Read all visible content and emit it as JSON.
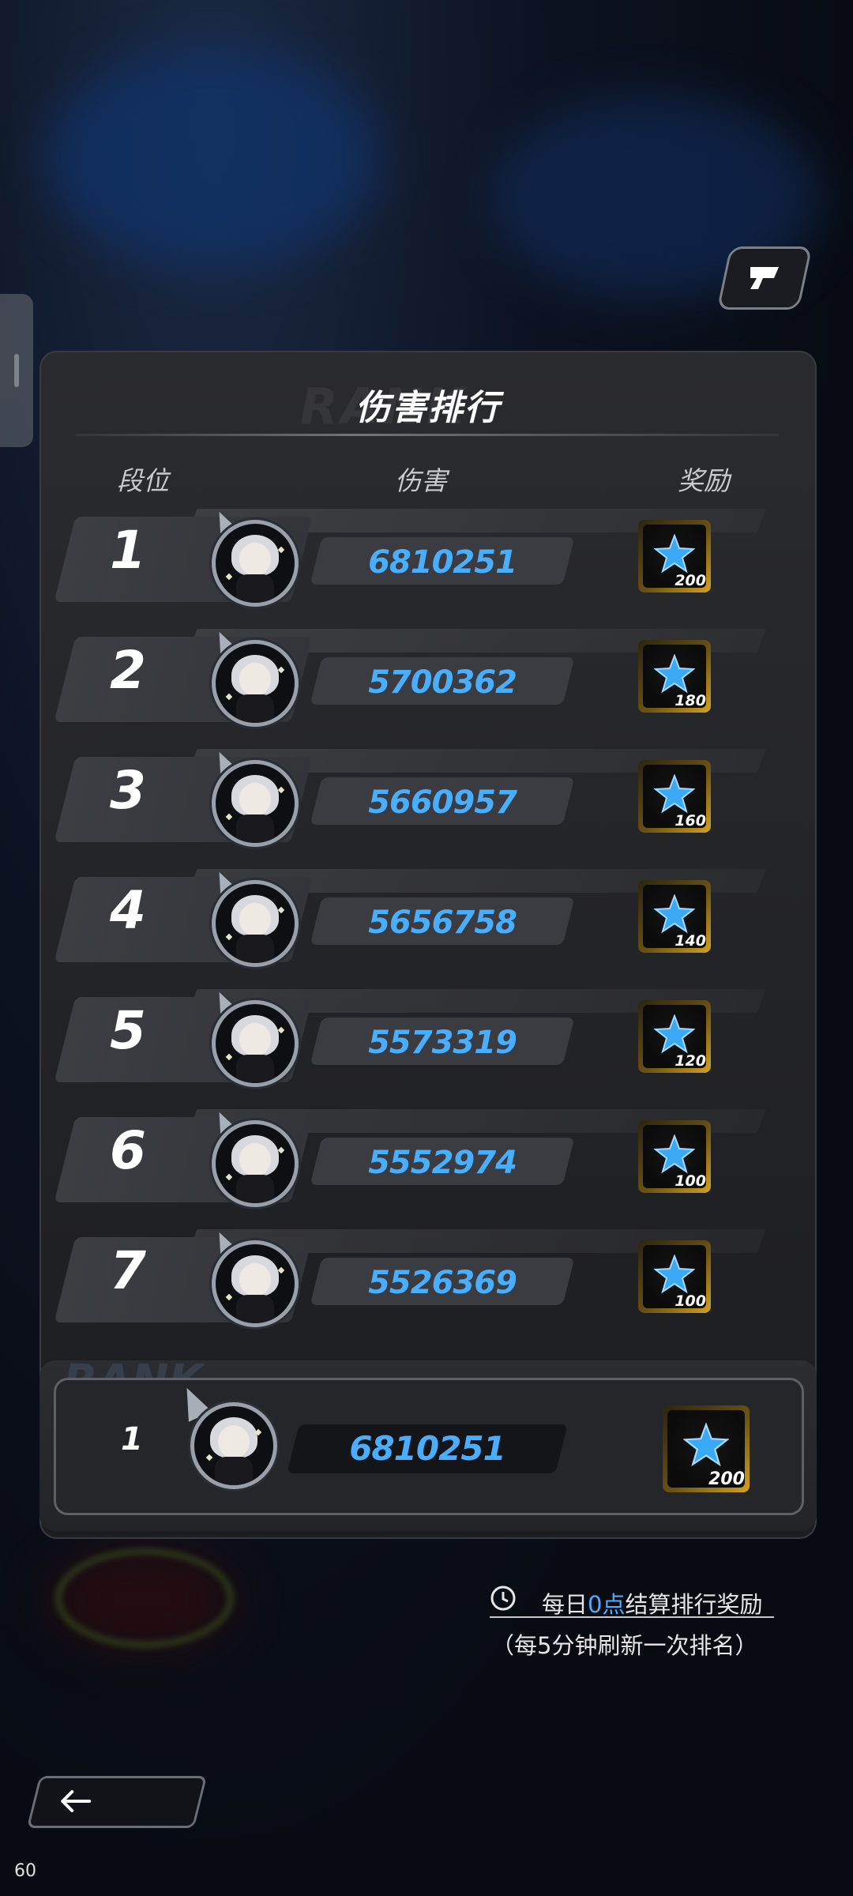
{
  "panel": {
    "title": "伤害排行",
    "columns": {
      "rank": "段位",
      "damage": "伤害",
      "reward": "奖励"
    }
  },
  "rows": [
    {
      "rank": "1",
      "damage": "6810251",
      "reward_qty": "200"
    },
    {
      "rank": "2",
      "damage": "5700362",
      "reward_qty": "180"
    },
    {
      "rank": "3",
      "damage": "5660957",
      "reward_qty": "160"
    },
    {
      "rank": "4",
      "damage": "5656758",
      "reward_qty": "140"
    },
    {
      "rank": "5",
      "damage": "5573319",
      "reward_qty": "120"
    },
    {
      "rank": "6",
      "damage": "5552974",
      "reward_qty": "100"
    },
    {
      "rank": "7",
      "damage": "5526369",
      "reward_qty": "100"
    }
  ],
  "self": {
    "rank": "1",
    "damage": "6810251",
    "reward_qty": "200"
  },
  "footer": {
    "note_prefix": "每日",
    "note_highlight": "0点",
    "note_suffix": "结算排行奖励",
    "refresh_note": "（每5分钟刷新一次排名）"
  },
  "icons": {
    "reward": "blue-star-icon",
    "share": "share-icon",
    "back": "back-arrow-icon",
    "clock": "clock-icon"
  },
  "colors": {
    "accent": "#4aaeff",
    "reward_gold": "#d6a21d"
  },
  "fps": "60"
}
